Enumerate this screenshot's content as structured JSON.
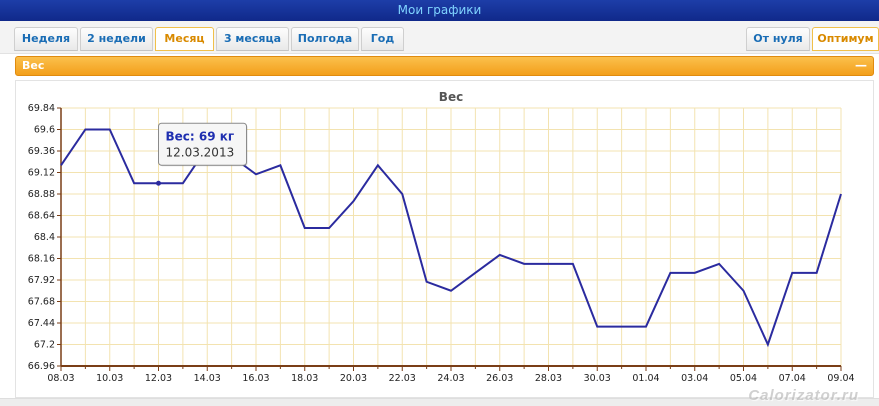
{
  "window": {
    "title": "Мои графики"
  },
  "tabs": [
    {
      "label": "Неделя",
      "active": false
    },
    {
      "label": "2 недели",
      "active": false
    },
    {
      "label": "Месяц",
      "active": true
    },
    {
      "label": "3 месяца",
      "active": false
    },
    {
      "label": "Полгода",
      "active": false
    },
    {
      "label": "Год",
      "active": false
    }
  ],
  "right_tabs": [
    {
      "label": "От нуля",
      "active": false
    },
    {
      "label": "Оптимум",
      "active": true
    }
  ],
  "panel": {
    "title": "Вес",
    "collapse_icon": "minus-icon"
  },
  "tooltip": {
    "line1": "Вес: 69 кг",
    "line2": "12.03.2013"
  },
  "watermark": "Calorizator.ru",
  "colors": {
    "accent": "#f5a623",
    "line": "#2b2b9f",
    "title_bar": "#1d3ea8",
    "grid": "#f3e3b0",
    "axis": "#7a3e17"
  },
  "chart_data": {
    "type": "line",
    "title": "Вес",
    "xlabel": "",
    "ylabel": "",
    "x": [
      "08.03",
      "09.03",
      "10.03",
      "11.03",
      "12.03",
      "13.03",
      "14.03",
      "15.03",
      "16.03",
      "17.03",
      "18.03",
      "19.03",
      "20.03",
      "21.03",
      "22.03",
      "23.03",
      "24.03",
      "25.03",
      "26.03",
      "27.03",
      "28.03",
      "29.03",
      "30.03",
      "31.03",
      "01.04",
      "02.04",
      "03.04",
      "04.04",
      "05.04",
      "06.04",
      "07.04",
      "08.04",
      "09.04"
    ],
    "series": [
      {
        "values": [
          69.2,
          69.6,
          69.6,
          69.0,
          69.0,
          69.0,
          69.4,
          69.3,
          69.1,
          69.2,
          68.5,
          68.5,
          68.8,
          69.2,
          68.88,
          67.9,
          67.8,
          68.0,
          68.2,
          68.1,
          68.1,
          68.1,
          67.4,
          67.4,
          67.4,
          68.0,
          68.0,
          68.1,
          67.8,
          67.2,
          68.0,
          68.0,
          68.88
        ]
      }
    ],
    "x_tick_labels": [
      "08.03",
      "10.03",
      "12.03",
      "14.03",
      "16.03",
      "18.03",
      "20.03",
      "22.03",
      "24.03",
      "26.03",
      "28.03",
      "30.03",
      "01.04",
      "03.04",
      "05.04",
      "07.04",
      "09.04"
    ],
    "y_tick_labels": [
      "69.84",
      "69.6",
      "69.36",
      "69.12",
      "68.88",
      "68.64",
      "68.4",
      "68.16",
      "67.92",
      "67.68",
      "67.44",
      "67.2",
      "66.96"
    ],
    "ylim": [
      66.96,
      69.84
    ],
    "grid": true,
    "legend": "none",
    "highlighted_point": {
      "x": "12.03",
      "y": 69.0
    }
  }
}
